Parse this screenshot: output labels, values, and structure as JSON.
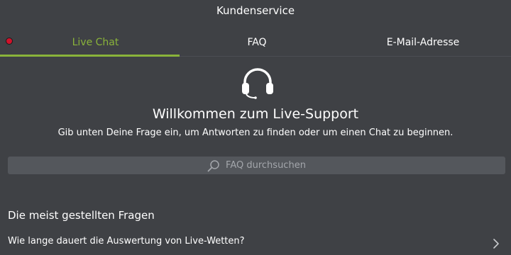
{
  "header": {
    "title": "Kundenservice"
  },
  "tabs": [
    {
      "label": "Live Chat",
      "active": true,
      "status": "offline"
    },
    {
      "label": "FAQ",
      "active": false
    },
    {
      "label": "E-Mail-Adresse",
      "active": false
    }
  ],
  "colors": {
    "accent": "#8ab33a",
    "status_offline": "#d0122b",
    "background": "#3f4145"
  },
  "welcome": {
    "icon": "headset-icon",
    "title": "Willkommen zum Live-Support",
    "subtitle": "Gib unten Deine Frage ein, um Antworten zu finden oder um einen Chat zu beginnen."
  },
  "search": {
    "icon": "search-icon",
    "placeholder": "FAQ durchsuchen"
  },
  "faq": {
    "heading": "Die meist gestellten Fragen",
    "items": [
      {
        "label": "Wie lange dauert die Auswertung von Live-Wetten?",
        "icon": "chevron-right-icon"
      }
    ]
  }
}
